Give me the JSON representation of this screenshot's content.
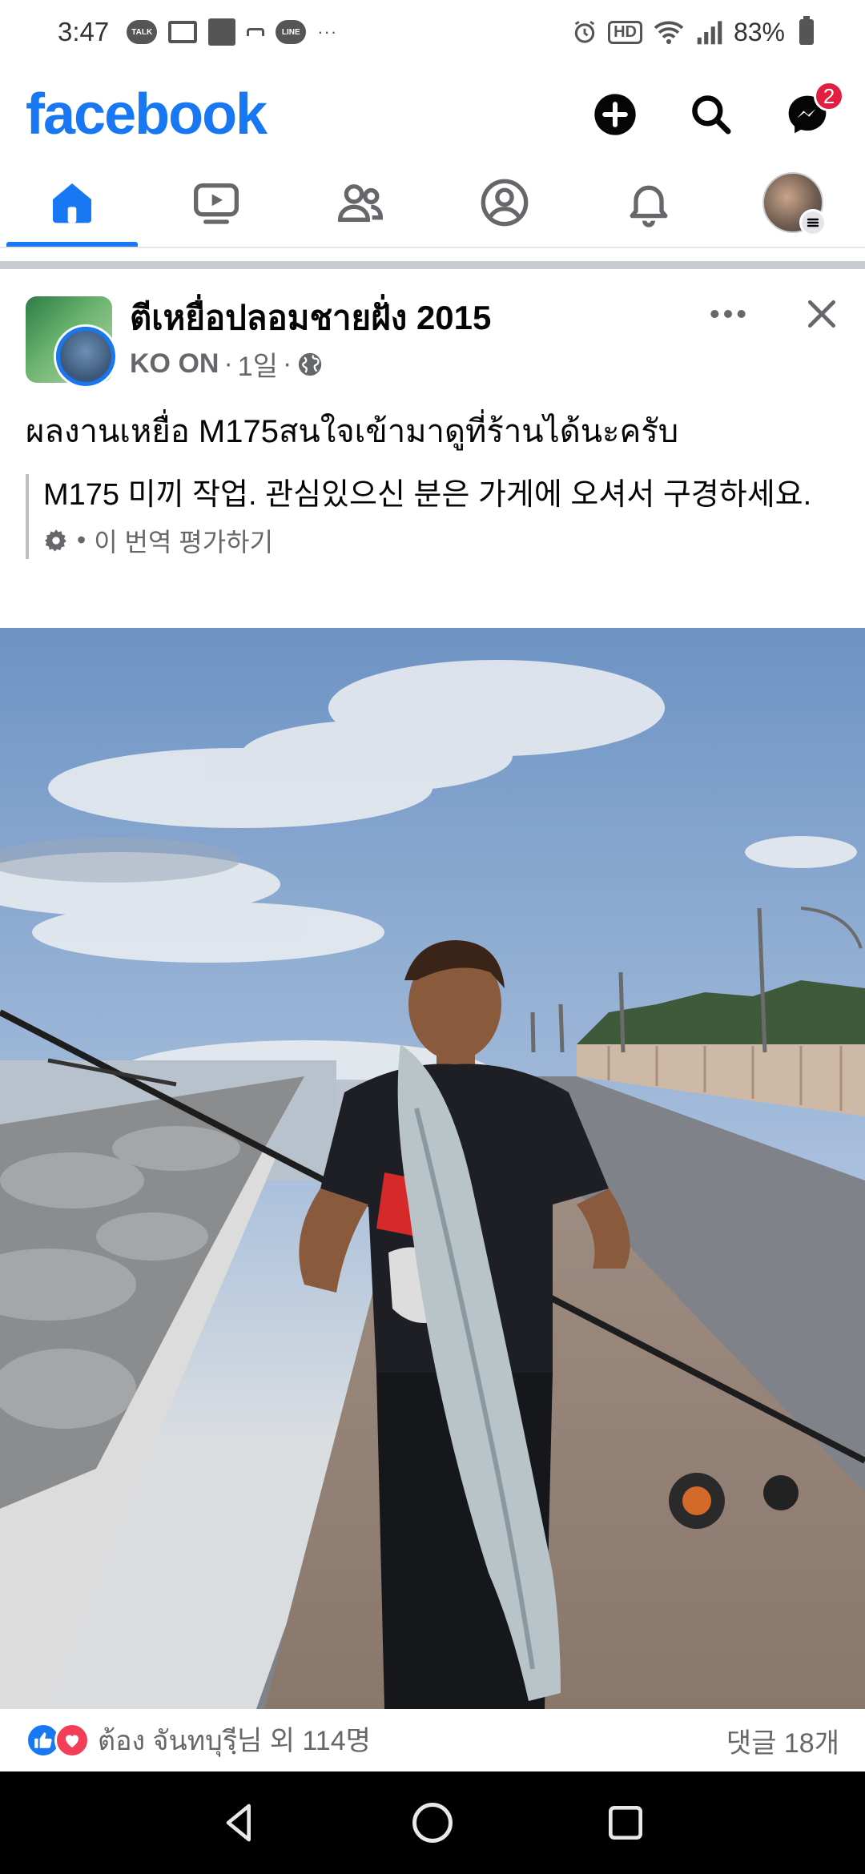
{
  "status_bar": {
    "time": "3:47",
    "icons": [
      "talk-icon",
      "gmail-icon",
      "app-icon",
      "bar-icon",
      "line-icon"
    ],
    "line_label": "LINE",
    "talk_label": "TALK",
    "overflow": "···",
    "hd": "HD",
    "battery": "83%"
  },
  "header": {
    "logo": "facebook",
    "messenger_badge": "2",
    "brand_color": "#1877f2"
  },
  "nav": {
    "tabs": [
      "home",
      "watch",
      "friends",
      "profile",
      "notifications",
      "menu"
    ],
    "active": "home"
  },
  "post": {
    "group_name": "ตีเหยื่อปลอมชายฝั่ง 2015",
    "author": "KO ON",
    "separator": "·",
    "time": "1일",
    "text": "ผลงานเหยื่อ M175สนใจเข้ามาดูที่ร้านได้นะครับ",
    "translation": {
      "text": "M175 미끼 작업. 관심있으신 분은 가게에 오셔서 구경하세요.",
      "rate_dot": "•",
      "rate_label": "이 번역 평가하기"
    }
  },
  "reactions": {
    "summary": "ต้อง จันทบุรีฺ님 외 114명",
    "comments": "댓글 18개"
  }
}
